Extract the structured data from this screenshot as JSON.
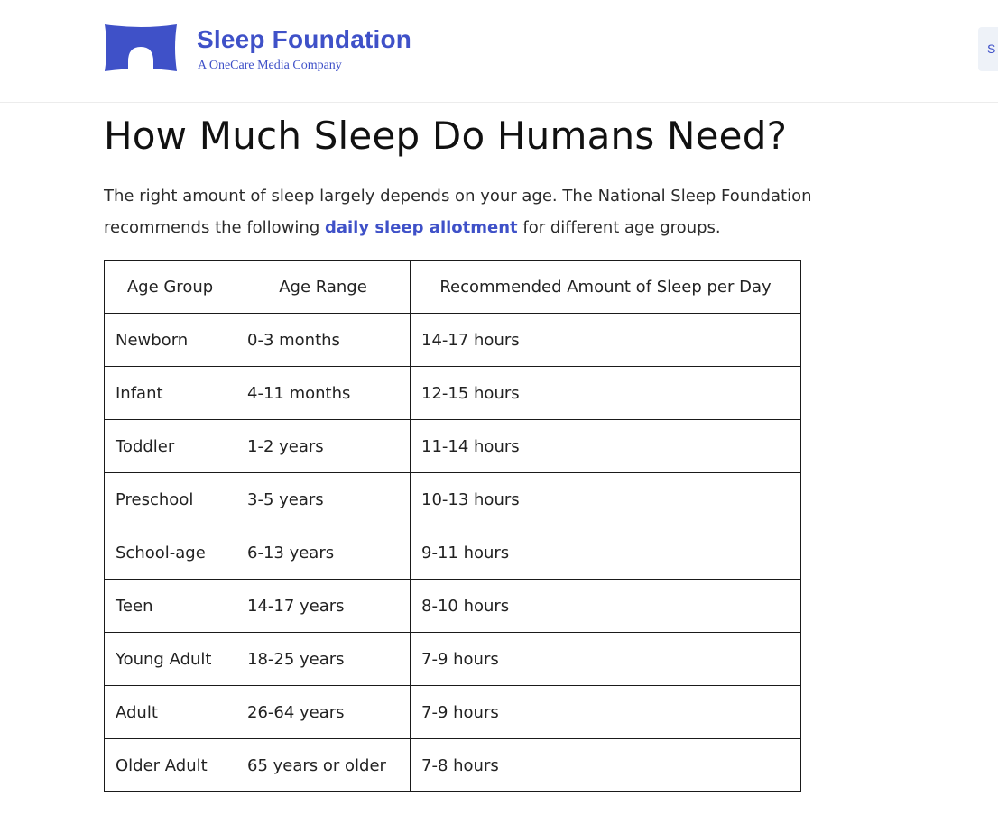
{
  "header": {
    "brand_name": "Sleep Foundation",
    "brand_tagline": "A OneCare Media Company",
    "logo_icon": "pillow-logo-icon",
    "brand_color": "#3f51c8",
    "right_button_text": "S"
  },
  "article": {
    "title": "How Much Sleep Do Humans Need?",
    "intro_part1": "The right amount of sleep largely depends on your age. The National Sleep Foundation recommends the following ",
    "intro_link": "daily sleep allotment",
    "intro_part2": " for different age groups."
  },
  "table": {
    "headers": [
      "Age Group",
      "Age Range",
      "Recommended Amount of Sleep per Day"
    ],
    "rows": [
      [
        "Newborn",
        "0-3 months",
        "14-17 hours"
      ],
      [
        "Infant",
        "4-11 months",
        "12-15 hours"
      ],
      [
        "Toddler",
        "1-2 years",
        "11-14 hours"
      ],
      [
        "Preschool",
        "3-5 years",
        "10-13 hours"
      ],
      [
        "School-age",
        "6-13 years",
        "9-11 hours"
      ],
      [
        "Teen",
        "14-17 years",
        "8-10 hours"
      ],
      [
        "Young Adult",
        "18-25 years",
        "7-9 hours"
      ],
      [
        "Adult",
        "26-64 years",
        "7-9 hours"
      ],
      [
        "Older Adult",
        "65 years or older",
        "7-8 hours"
      ]
    ]
  }
}
